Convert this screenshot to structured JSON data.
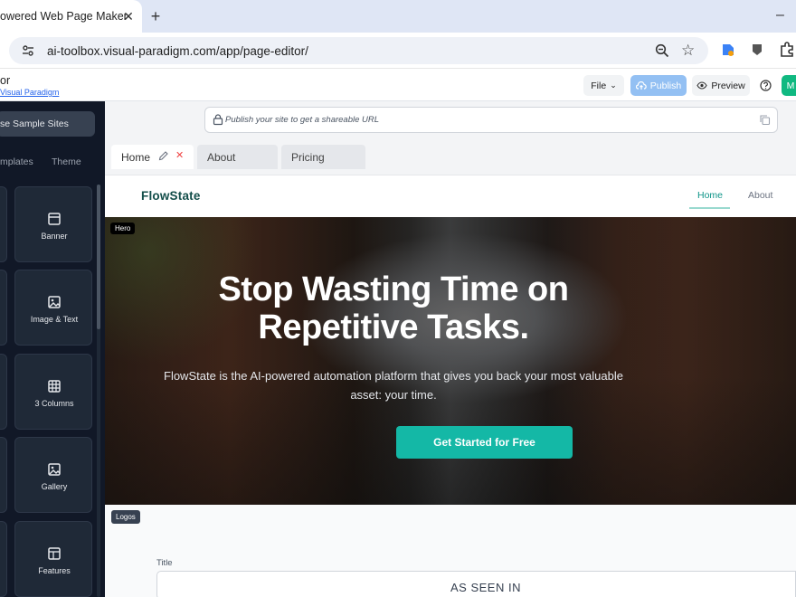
{
  "browser": {
    "tab_title": "owered Web Page Maker",
    "url": "ai-toolbox.visual-paradigm.com/app/page-editor/"
  },
  "app": {
    "name": "or",
    "brand": "Visual Paradigm",
    "file_label": "File",
    "publish_label": "Publish",
    "preview_label": "Preview",
    "m_label": "M"
  },
  "sidebar": {
    "sample_sites": "se Sample Sites",
    "tabs": [
      "mplates",
      "Theme"
    ],
    "blocks": [
      "Banner",
      "Image & Text",
      "3 Columns",
      "Gallery",
      "Features"
    ]
  },
  "editor": {
    "share_placeholder": "Publish your site to get a shareable URL",
    "page_tabs": [
      "Home",
      "About",
      "Pricing"
    ]
  },
  "site": {
    "logo": "FlowState",
    "nav": [
      "Home",
      "About"
    ],
    "hero_tag": "Hero",
    "hero_title_1": "Stop Wasting Time on",
    "hero_title_2": "Repetitive Tasks.",
    "hero_sub_1": "FlowState is the AI-powered automation platform that gives you back your most valuable",
    "hero_sub_2": "asset: your time.",
    "cta": "Get Started for Free",
    "logos_tag": "Logos",
    "title_label": "Title",
    "title_value": "AS SEEN IN"
  },
  "colors": {
    "accent": "#14b8a6",
    "sidebar_bg": "#111827",
    "publish": "#93c0f3",
    "m_button": "#10b981"
  }
}
